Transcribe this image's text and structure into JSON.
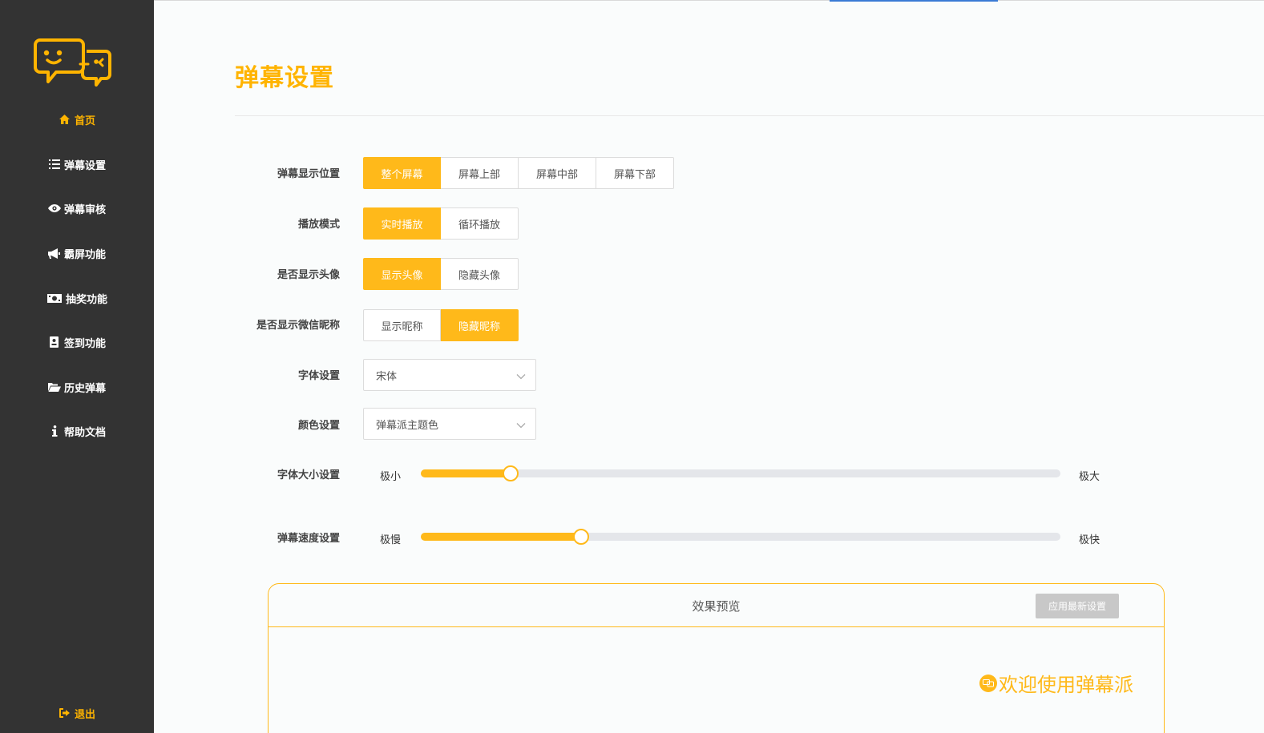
{
  "sidebar": {
    "items": [
      {
        "label": "首页",
        "icon": "home-icon"
      },
      {
        "label": "弹幕设置",
        "icon": "list-icon"
      },
      {
        "label": "弹幕审核",
        "icon": "eye-icon"
      },
      {
        "label": "霸屏功能",
        "icon": "megaphone-icon"
      },
      {
        "label": "抽奖功能",
        "icon": "money-icon"
      },
      {
        "label": "签到功能",
        "icon": "badge-icon"
      },
      {
        "label": "历史弹幕",
        "icon": "folder-open-icon"
      },
      {
        "label": "帮助文档",
        "icon": "info-icon"
      }
    ],
    "logout": "退出"
  },
  "page": {
    "title": "弹幕设置"
  },
  "form": {
    "position": {
      "label": "弹幕显示位置",
      "options": [
        "整个屏幕",
        "屏幕上部",
        "屏幕中部",
        "屏幕下部"
      ],
      "selected": 0
    },
    "mode": {
      "label": "播放模式",
      "options": [
        "实时播放",
        "循环播放"
      ],
      "selected": 0
    },
    "avatar": {
      "label": "是否显示头像",
      "options": [
        "显示头像",
        "隐藏头像"
      ],
      "selected": 0
    },
    "nickname": {
      "label": "是否显示微信昵称",
      "options": [
        "显示昵称",
        "隐藏昵称"
      ],
      "selected": 1
    },
    "font": {
      "label": "字体设置",
      "value": "宋体"
    },
    "color": {
      "label": "颜色设置",
      "value": "弹幕派主题色"
    },
    "font_size": {
      "label": "字体大小设置",
      "min_label": "极小",
      "max_label": "极大",
      "value": 0.14
    },
    "speed": {
      "label": "弹幕速度设置",
      "min_label": "极慢",
      "max_label": "极快",
      "value": 0.25
    }
  },
  "preview": {
    "title": "效果预览",
    "apply_label": "应用最新设置",
    "sample_text": "欢迎使用弹幕派"
  },
  "colors": {
    "accent": "#ffb91a",
    "sidebar_bg": "#333333"
  }
}
